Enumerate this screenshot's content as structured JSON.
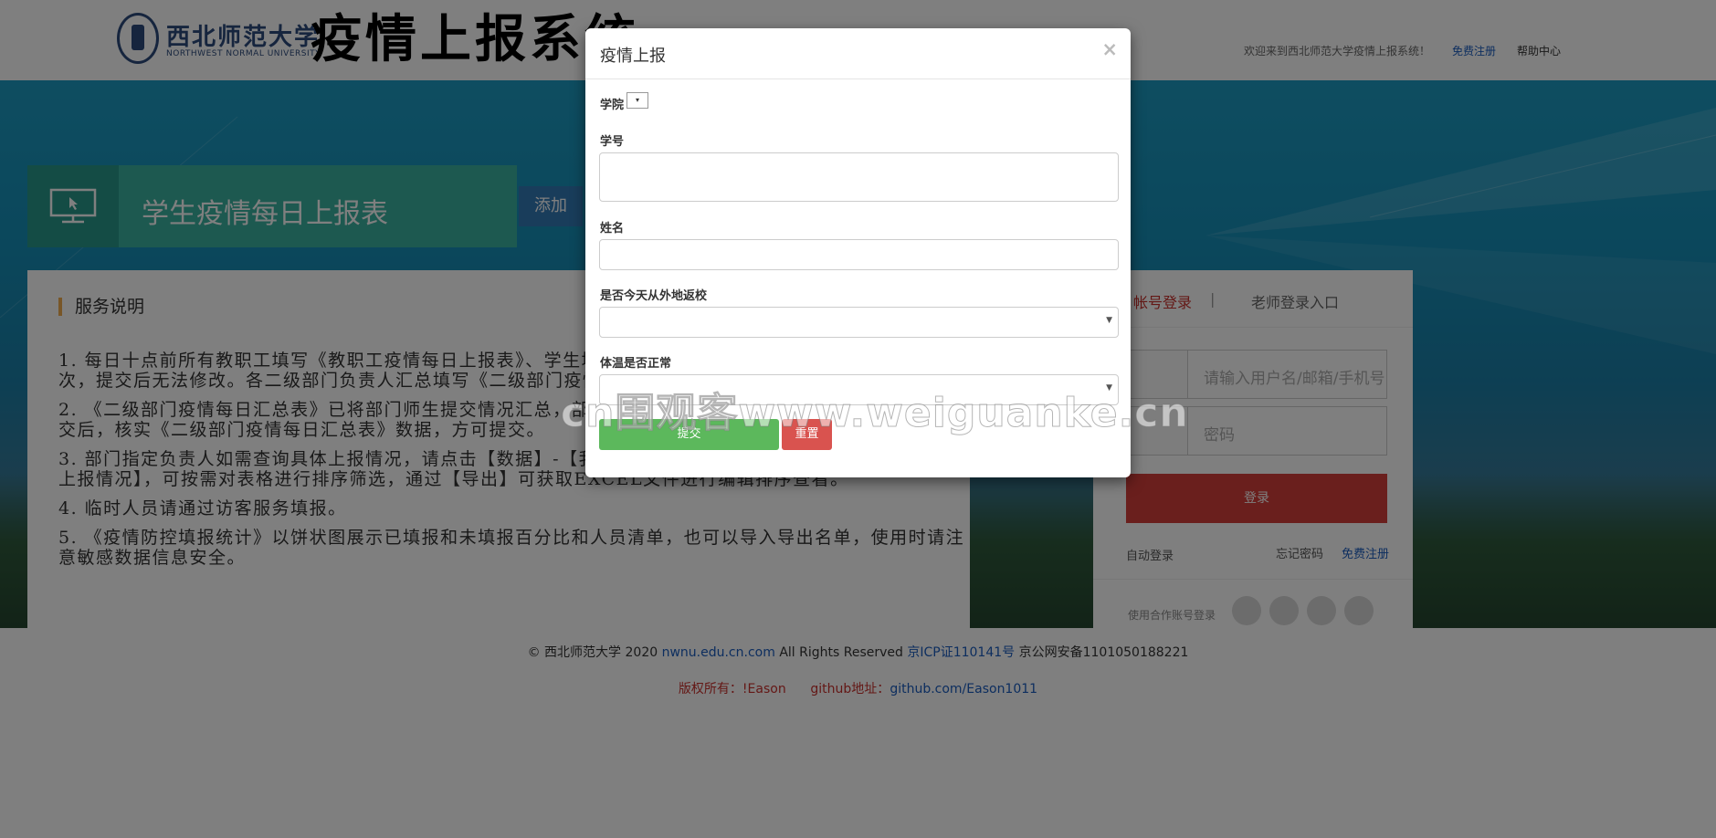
{
  "header": {
    "logo_cn": "西北师范大学",
    "logo_en": "NORTHWEST NORMAL UNIVERSITY",
    "system_title": "疫情上报系统",
    "welcome": "欢迎来到西北师范大学疫情上报系统！",
    "register": "免费注册",
    "help": "帮助中心"
  },
  "hero": {
    "title": "学生疫情每日上报表",
    "add_button": "添加"
  },
  "service": {
    "title": "服务说明",
    "items": [
      "1. 每日十点前所有教职工填写《教职工疫情每日上报表》、学生填写《学生疫情每日上报表》，每日只可上报一次，提交后无法修改。各二级部门负责人汇总填写《二级部门疫情每日汇总表》。",
      "2. 《二级部门疫情每日汇总表》已将部门师生提交情况汇总，部门负责人确认本部门所有师生已全部填写并提交后，核实《二级部门疫情每日汇总表》数据，方可提交。",
      "3. 部门指定负责人如需查询具体上报情况，请点击【数据】-【我的分享】-【分享给我的】-【教职工学生疫情上报情况】，可按需对表格进行排序筛选，通过【导出】可获取EXCEL文件进行编辑排序查看。",
      "4. 临时人员请通过访客服务填报。",
      "5. 《疫情防控填报统计》以饼状图展示已填报和未填报百分比和人员清单，也可以导入导出名单，使用时请注意敏感数据信息安全。"
    ]
  },
  "login": {
    "tab_account": "帐号登录",
    "tab_sep": "|",
    "tab_teacher": "老师登录入口",
    "username_placeholder": "请输入用户名/邮箱/手机号",
    "password_placeholder": "密码",
    "login_button": "登录",
    "auto_login": "自动登录",
    "forget_password": "忘记密码",
    "register": "免费注册",
    "social_label": "使用合作账号登录",
    "social_icons": [
      "qq-icon",
      "weibo-icon",
      "alipay-icon",
      "baidu-icon"
    ]
  },
  "footer": {
    "copyright": "©  西北师范大学  2020",
    "domain": "nwnu.edu.cn.com",
    "rights": "All  Rights Reserved",
    "icp": "京ICP证110141号",
    "police": "京公网安备1101050188221",
    "owner": "版权所有：!Eason",
    "github_label": "github地址：",
    "github_url": "github.com/Eason1011"
  },
  "modal": {
    "title": "疫情上报",
    "close": "×",
    "college_label": "学院",
    "college_value": "▾",
    "student_id_label": "学号",
    "name_label": "姓名",
    "returned_label": "是否今天从外地返校",
    "returned_value": "",
    "temperature_label": "体温是否正常",
    "temperature_value": "",
    "submit": "提交",
    "reset": "重置"
  },
  "watermark": "cn围观客www.weiguanke.cn",
  "colors": {
    "primary": "#337ab7",
    "success": "#5cb85c",
    "danger": "#d9534f",
    "teal": "#3bb2a0",
    "link": "#1a5cbf"
  }
}
